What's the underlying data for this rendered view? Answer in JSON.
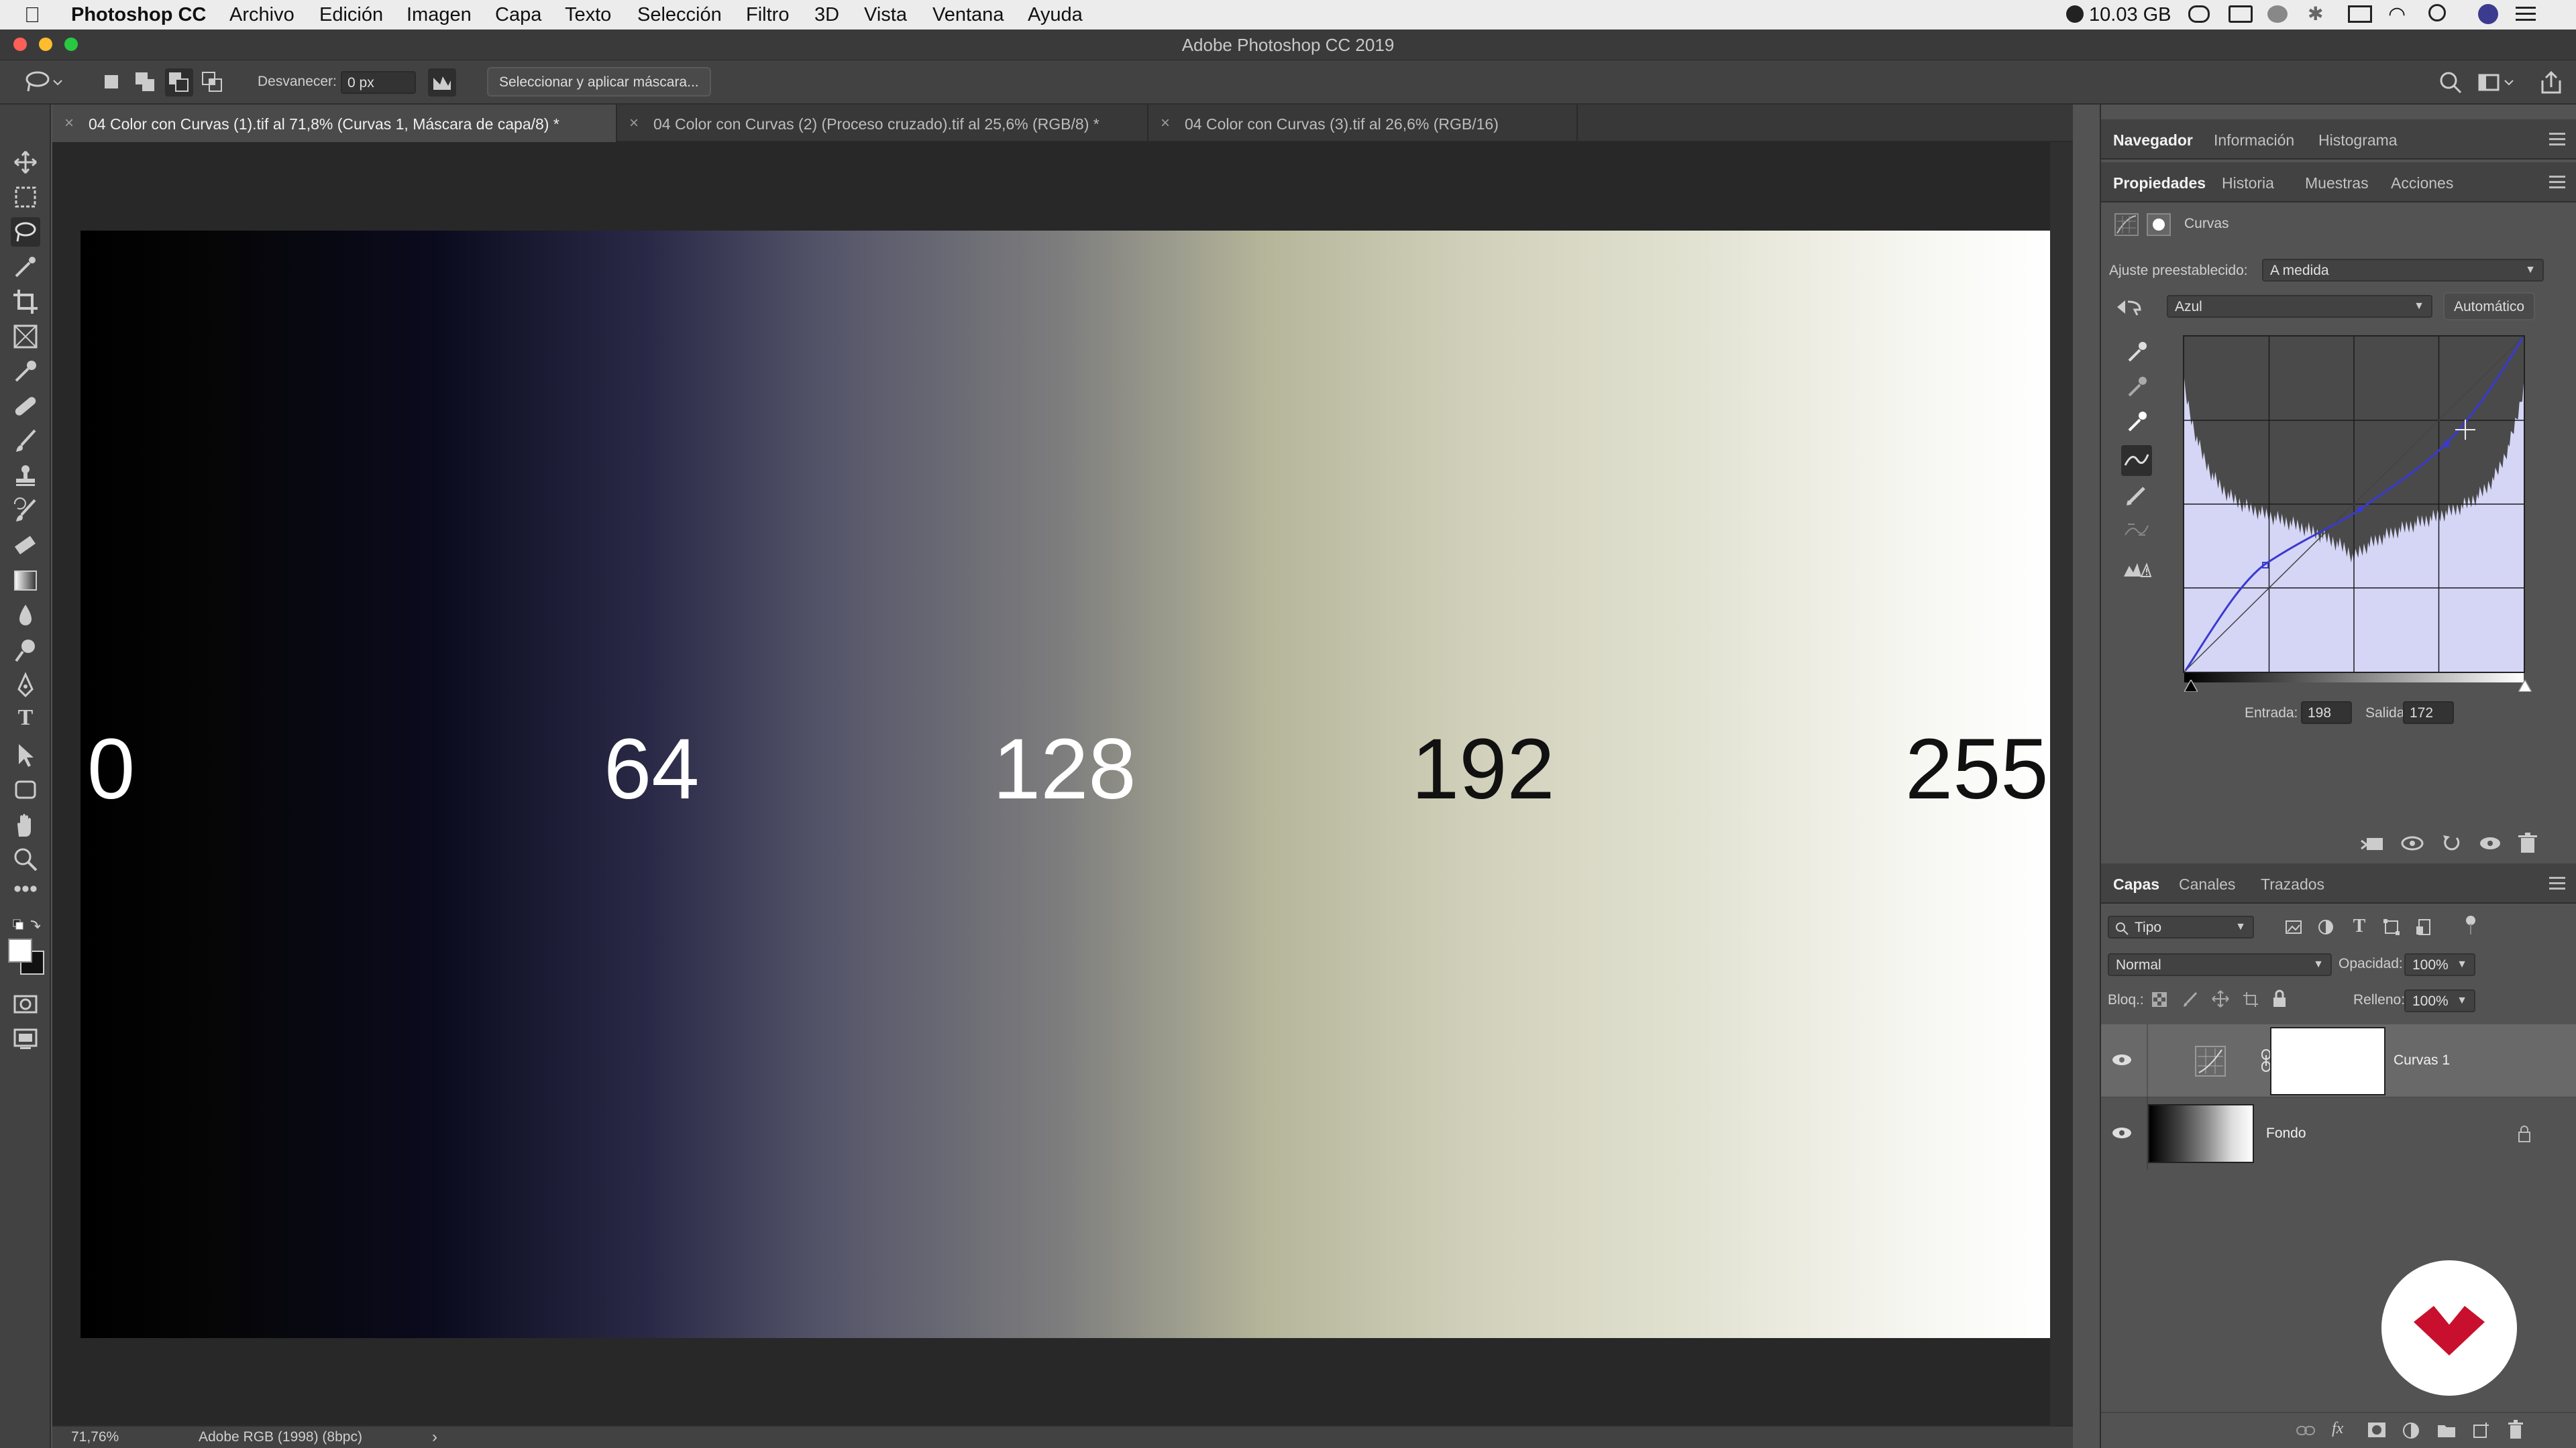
{
  "menubar": {
    "app": "Photoshop CC",
    "items": [
      "Archivo",
      "Edición",
      "Imagen",
      "Capa",
      "Texto",
      "Selección",
      "Filtro",
      "3D",
      "Vista",
      "Ventana",
      "Ayuda"
    ],
    "status": "10.03 GB"
  },
  "window": {
    "title": "Adobe Photoshop CC 2019"
  },
  "options": {
    "feather_label": "Desvanecer:",
    "feather_value": "0 px",
    "mask_button": "Seleccionar y aplicar máscara..."
  },
  "tabs": [
    "04 Color con Curvas (1).tif al 71,8% (Curvas 1, Máscara de capa/8) *",
    "04 Color con Curvas (2) (Proceso cruzado).tif al 25,6% (RGB/8) *",
    "04 Color con Curvas (3).tif al 26,6% (RGB/16)"
  ],
  "canvas": {
    "labels": [
      "0",
      "64",
      "128",
      "192",
      "255"
    ]
  },
  "status": {
    "zoom": "71,76%",
    "profile": "Adobe RGB (1998) (8bpc)",
    "arrow": "›"
  },
  "panels": {
    "top_tabs": [
      "Navegador",
      "Información",
      "Histograma"
    ],
    "prop_tabs": [
      "Propiedades",
      "Historia",
      "Muestras",
      "Acciones"
    ],
    "props_title": "Curvas",
    "preset_label": "Ajuste preestablecido:",
    "preset_value": "A medida",
    "channel_value": "Azul",
    "auto_button": "Automático",
    "input_label": "Entrada:",
    "input_value": "198",
    "output_label": "Salida:",
    "output_value": "172"
  },
  "layers": {
    "tabs": [
      "Capas",
      "Canales",
      "Trazados"
    ],
    "filter_value": "Tipo",
    "blend_mode": "Normal",
    "opacity_label": "Opacidad:",
    "opacity_value": "100%",
    "lock_label": "Bloq.:",
    "fill_label": "Relleno:",
    "fill_value": "100%",
    "items": [
      {
        "name": "Curvas 1"
      },
      {
        "name": "Fondo"
      }
    ]
  },
  "colors": {
    "accent_curve": "#3a3ad0",
    "graph_bg": "#d5d6f6",
    "logo_red": "#c8102e"
  }
}
